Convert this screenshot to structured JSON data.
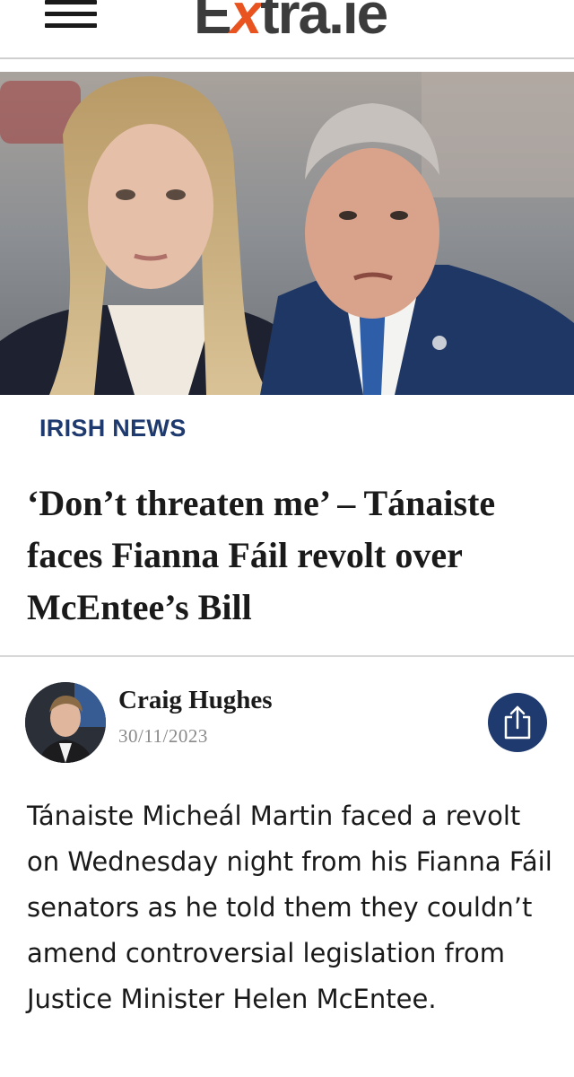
{
  "header": {
    "logo_prefix": "E",
    "logo_x": "x",
    "logo_suffix": "tra.ie",
    "menu_icon": "hamburger-icon"
  },
  "hero": {
    "image": "photo-two-politicians"
  },
  "article": {
    "section": "IRISH NEWS",
    "headline": "‘Don’t threaten me’ – Tánaiste faces Fianna Fáil revolt over McEntee’s Bill",
    "author": {
      "name": "Craig Hughes",
      "date": "30/11/2023"
    },
    "share_icon": "share-icon",
    "body": "Tánaiste Micheál Martin faced a revolt on Wednesday night from his Fianna Fáil senators as he told them they couldn’t amend controversial legislation from Justice Minister Helen McEntee."
  },
  "colors": {
    "accent": "#1f3a6e",
    "logo_orange": "#e8531f",
    "logo_grey": "#3c3c3c"
  }
}
